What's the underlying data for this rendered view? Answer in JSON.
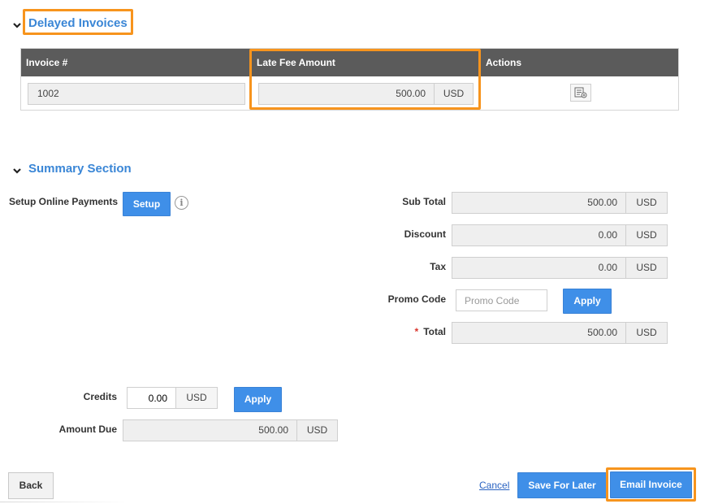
{
  "delayed_invoices": {
    "title": "Delayed Invoices",
    "columns": [
      "Invoice #",
      "Late Fee Amount",
      "Actions"
    ],
    "rows": [
      {
        "invoice_number": "1002",
        "late_fee_amount": "500.00",
        "currency": "USD"
      }
    ]
  },
  "summary": {
    "title": "Summary Section",
    "setup_online_payments_label": "Setup Online Payments",
    "setup_button": "Setup",
    "info_glyph": "i",
    "sub_total_label": "Sub Total",
    "sub_total_value": "500.00",
    "discount_label": "Discount",
    "discount_value": "0.00",
    "tax_label": "Tax",
    "tax_value": "0.00",
    "promo_code_label": "Promo Code",
    "promo_code_placeholder": "Promo Code",
    "promo_apply_button": "Apply",
    "total_required_marker": "*",
    "total_label": "Total",
    "total_value": "500.00",
    "currency": "USD",
    "credits_label": "Credits",
    "credits_value": "0.00",
    "credits_apply_button": "Apply",
    "amount_due_label": "Amount Due",
    "amount_due_value": "500.00"
  },
  "footer": {
    "back_button": "Back",
    "cancel_link": "Cancel",
    "save_for_later_button": "Save For Later",
    "email_invoice_button": "Email Invoice"
  },
  "colors": {
    "accent_blue": "#3f8fe8",
    "section_title": "#3a86d6",
    "highlight_orange": "#f7941d",
    "table_header": "#5b5b5b"
  }
}
